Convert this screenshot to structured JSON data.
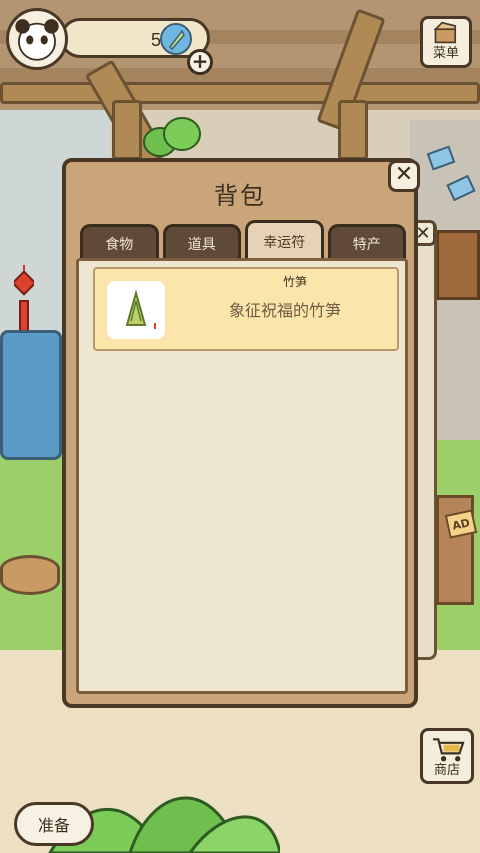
{
  "hud": {
    "clover_count": "508",
    "plus_label": "+",
    "menu_label": "菜单"
  },
  "backpack": {
    "title": "背包",
    "close_label": "✕",
    "tabs": [
      {
        "label": "食物",
        "active": false
      },
      {
        "label": "道具",
        "active": false
      },
      {
        "label": "幸运符",
        "active": true
      },
      {
        "label": "特产",
        "active": false
      }
    ],
    "items": [
      {
        "name": "竹笋",
        "description": "象征祝福的竹笋",
        "icon": "bamboo-shoot-icon"
      }
    ]
  },
  "background": {
    "ad_tag": "AD",
    "behind_close_label": "✕"
  },
  "footer": {
    "prepare_label": "准备",
    "shop_label": "商店"
  },
  "colors": {
    "panel": "#caa57a",
    "outline": "#4a3826",
    "tab_dark": "#5e4a36",
    "tab_active": "#e6d2b4",
    "item_card": "#fbe5aa",
    "content_bg": "#efe6d2"
  }
}
